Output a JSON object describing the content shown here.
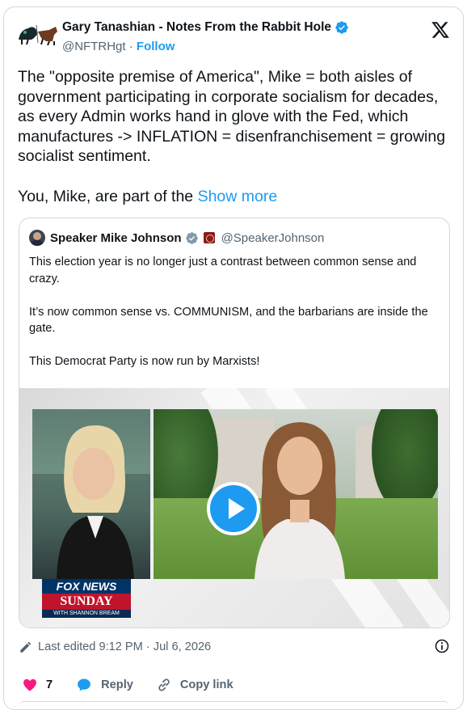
{
  "author": {
    "name": "Gary Tanashian - Notes From the Rabbit Hole",
    "handle": "@NFTRHgt",
    "separator": "·",
    "follow_label": "Follow"
  },
  "tweet": {
    "paragraph1": "The \"opposite premise of America\", Mike = both aisles of government participating in corporate socialism for decades, as every Admin works hand in glove with the Fed, which manufactures -> INFLATION = disenfranchisement = growing socialist sentiment.",
    "paragraph2": "You, Mike, are part of the ",
    "show_more": "Show more"
  },
  "quote": {
    "name": "Speaker Mike Johnson",
    "handle": "@SpeakerJohnson",
    "paragraphs": [
      "This election year is no longer just a contrast between common sense and crazy.",
      "It’s now common sense vs. COMMUNISM, and the barbarians are inside the gate.",
      "This Democrat Party is now run by Marxists!"
    ],
    "video": {
      "logo_line1": "FOX NEWS",
      "logo_line2": "SUNDAY",
      "logo_line3": "WITH SHANNON BREAM"
    }
  },
  "footer": {
    "edited_text": "Last edited 9:12 PM · Jul 6, 2026"
  },
  "actions": {
    "like_count": "7",
    "reply_label": "Reply",
    "copy_label": "Copy link"
  },
  "colors": {
    "accent": "#1d9bf0",
    "like": "#f91880",
    "text": "#0f1419",
    "muted": "#536471"
  }
}
